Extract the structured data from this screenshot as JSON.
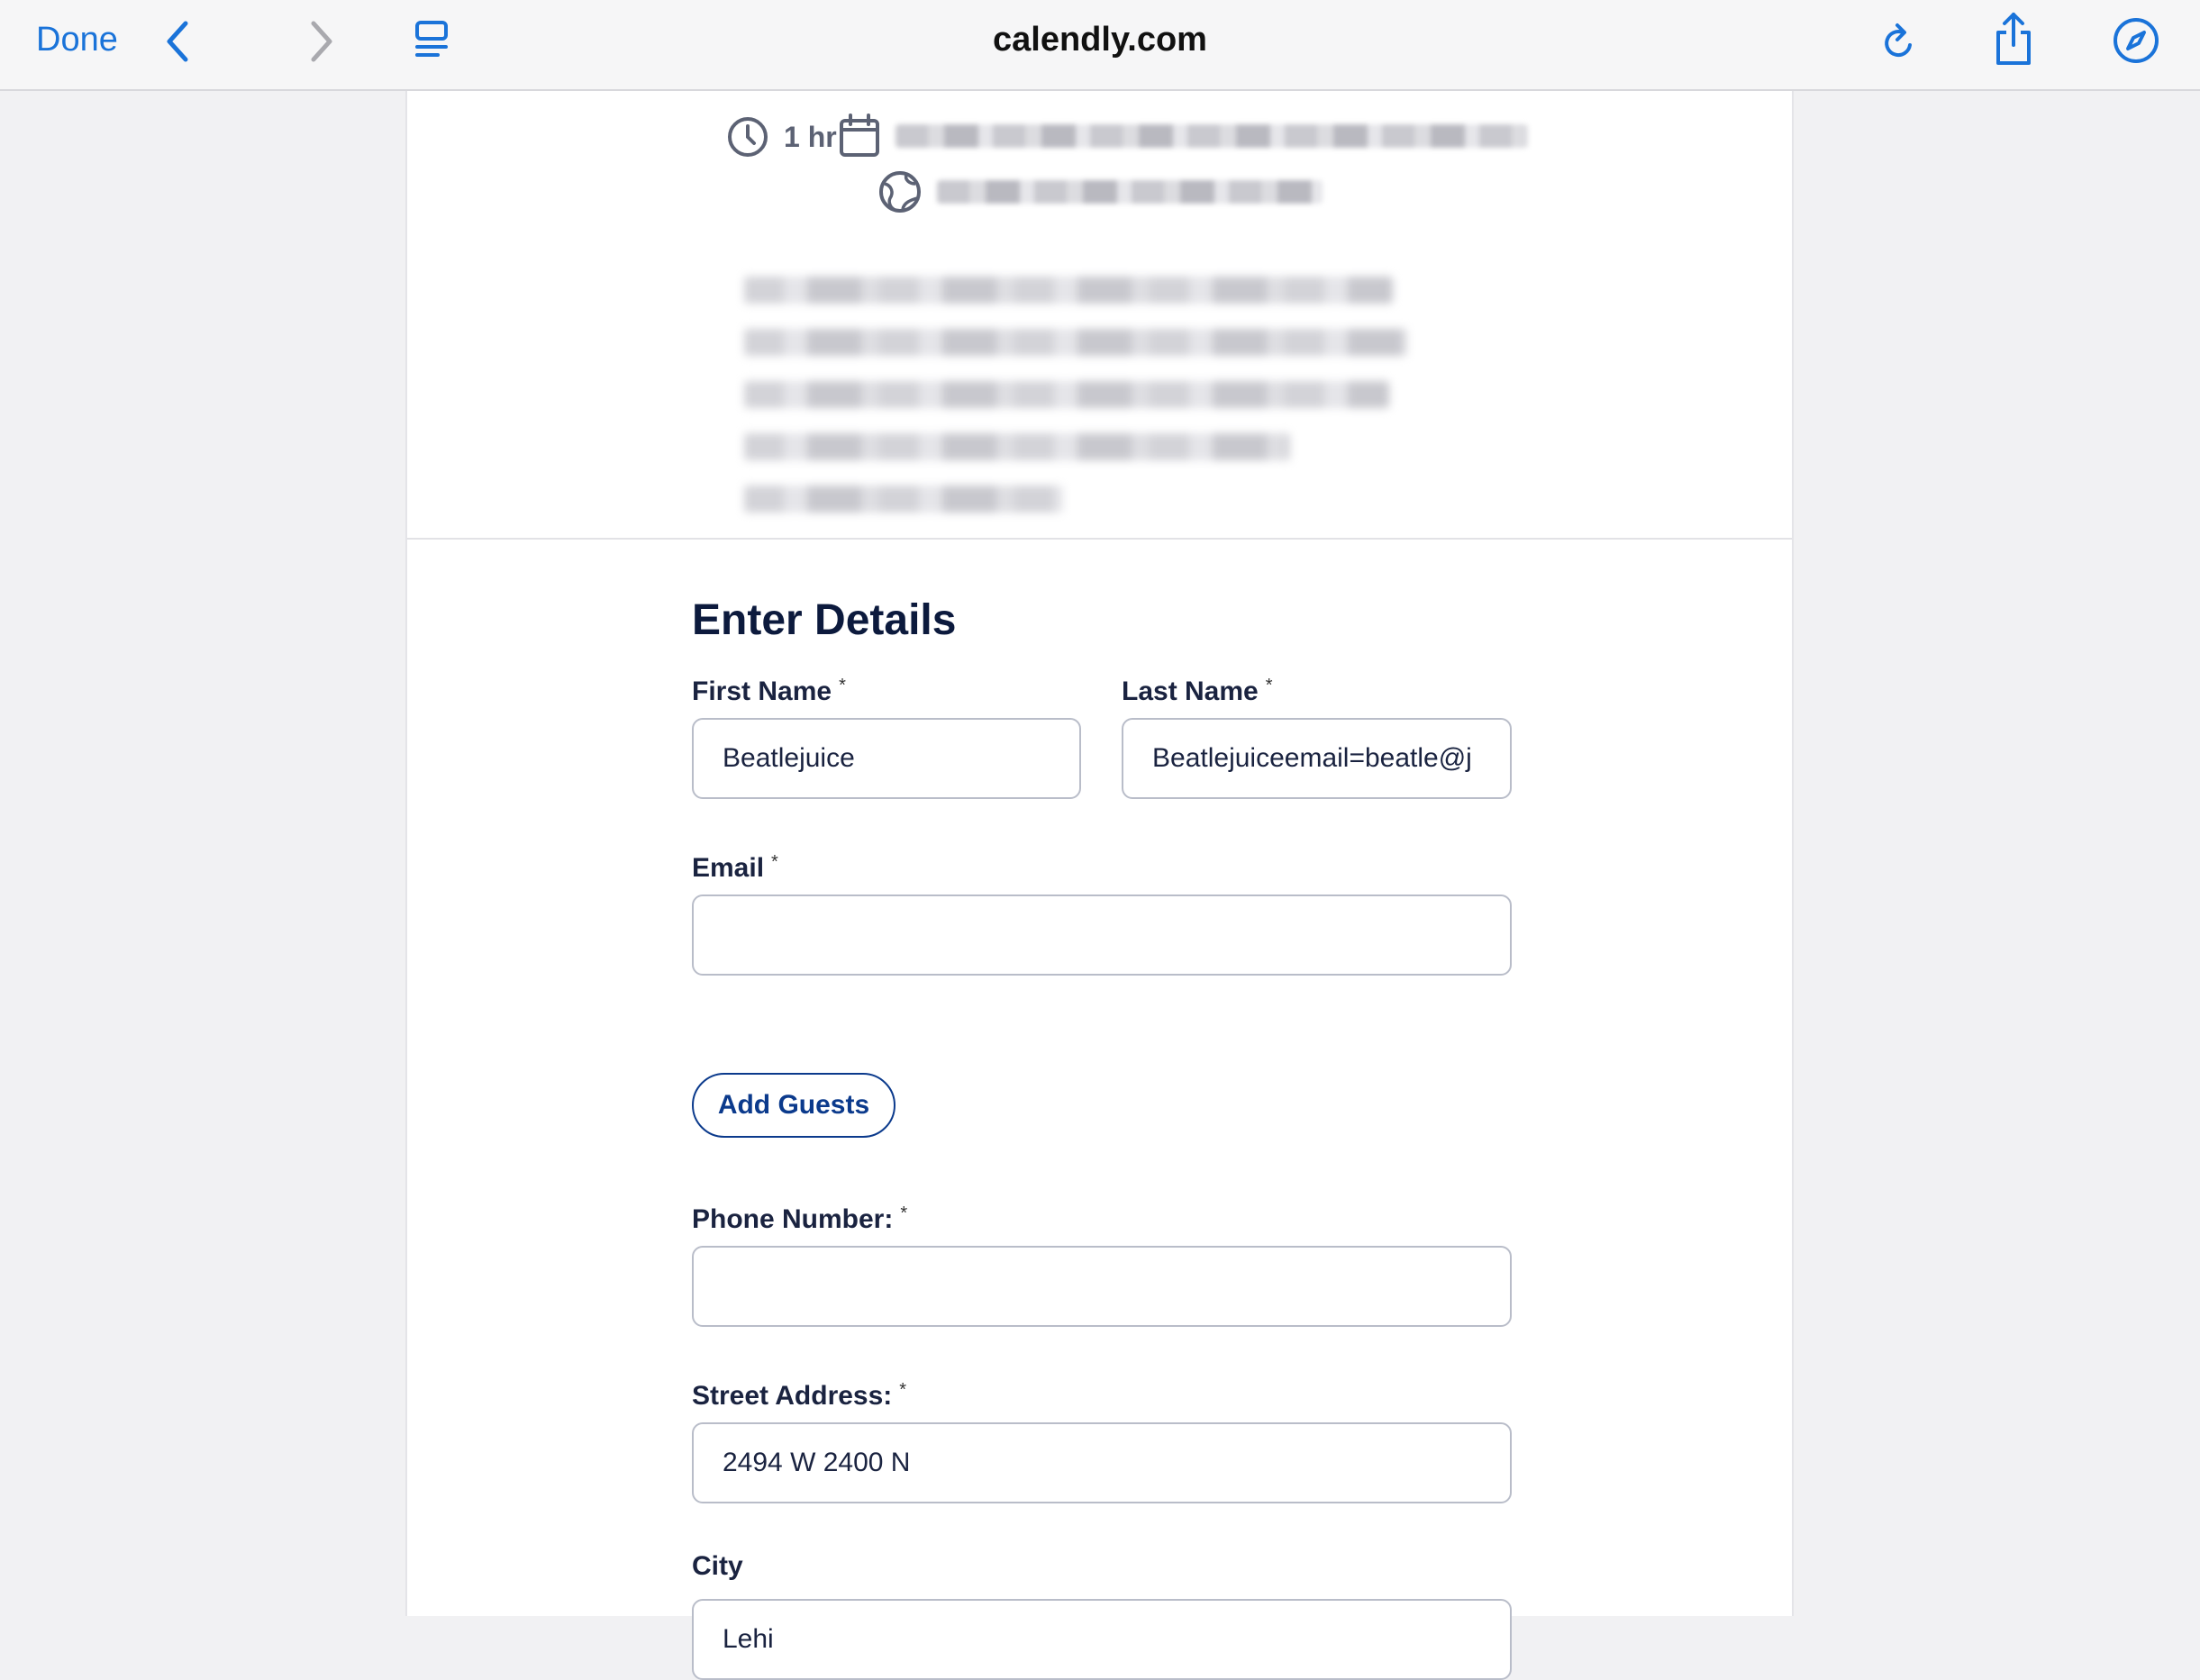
{
  "browser": {
    "done_label": "Done",
    "url": "calendly.com",
    "icons": [
      "chevron-left-icon",
      "chevron-right-icon",
      "reader-icon",
      "reload-icon",
      "share-icon",
      "compass-icon"
    ]
  },
  "event": {
    "duration": "1 hr",
    "icons": [
      "clock-icon",
      "calendar-icon",
      "globe-icon"
    ]
  },
  "form": {
    "title": "Enter Details",
    "required_mark": "*",
    "first_name": {
      "label": "First Name",
      "value": "Beatlejuice"
    },
    "last_name": {
      "label": "Last Name",
      "value": "Beatlejuiceemail=beatle@j"
    },
    "email": {
      "label": "Email",
      "value": ""
    },
    "add_guests_label": "Add Guests",
    "phone": {
      "label": "Phone Number:",
      "value": ""
    },
    "street": {
      "label": "Street Address:",
      "value": "2494 W 2400 N"
    },
    "city": {
      "label": "City",
      "value": "Lehi"
    }
  },
  "colors": {
    "browser_accent": "#1a73d9",
    "brand_navy": "#0b3a8c",
    "heading": "#0c1a3d",
    "field_border": "#b9bdc9"
  }
}
